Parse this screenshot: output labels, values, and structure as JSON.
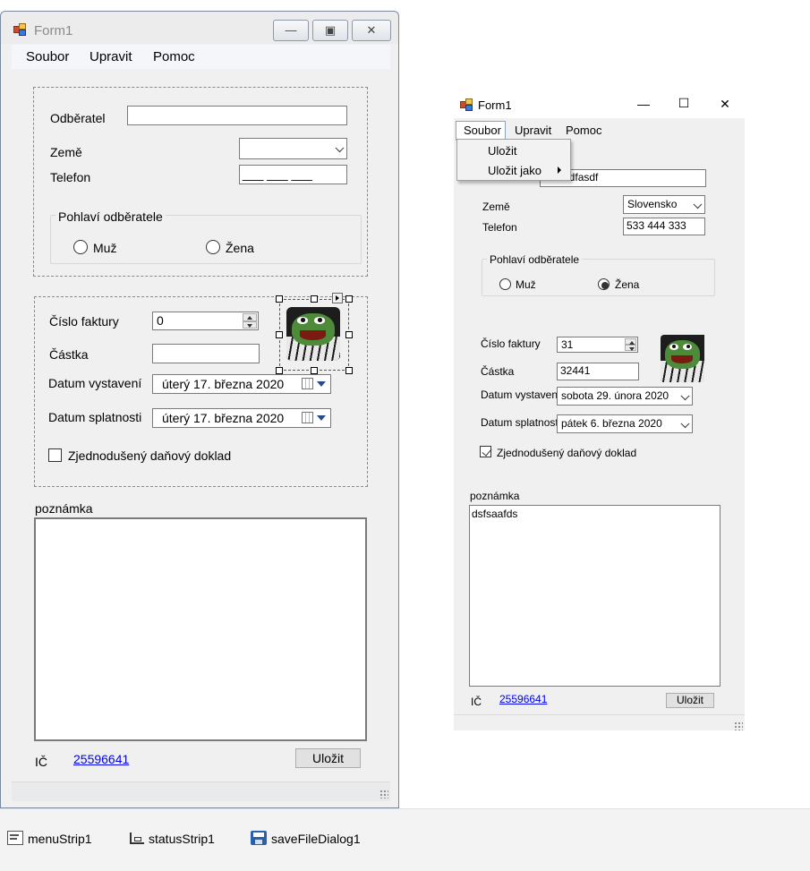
{
  "designer": {
    "title": "Form1",
    "caption_buttons": {
      "minimize": "—",
      "maximize": "▣",
      "close": "✕"
    },
    "menu": [
      "Soubor",
      "Upravit",
      "Pomoc"
    ],
    "labels": {
      "odberatel": "Odběratel",
      "zeme": "Země",
      "telefon": "Telefon",
      "pohlavi_group": "Pohlaví odběratele",
      "muz": "Muž",
      "zena": "Žena",
      "cislo_faktury": "Číslo faktury",
      "castka": "Částka",
      "datum_vystaveni": "Datum vystavení",
      "datum_splatnosti": "Datum splatnosti",
      "zjednoduseny": "Zjednodušený daňový doklad",
      "poznamka": "poznámka",
      "ic": "IČ"
    },
    "values": {
      "odberatel": "",
      "zeme": "",
      "telefon_mask": "___ ___ ___",
      "cislo_faktury": "0",
      "castka": "",
      "datum_vystaveni": "úterý   17.   března   2020",
      "datum_splatnosti": "úterý   17.   března   2020",
      "poznamka": ""
    },
    "ic_link": "25596641",
    "save_button": "Uložit"
  },
  "runtime": {
    "title": "Form1",
    "caption_buttons": {
      "minimize": "—",
      "maximize": "☐",
      "close": "✕"
    },
    "menu": [
      "Soubor",
      "Upravit",
      "Pomoc"
    ],
    "dropdown": [
      "Uložit",
      "Uložit jako"
    ],
    "labels": {
      "zeme": "Země",
      "telefon": "Telefon",
      "pohlavi_group": "Pohlaví odběratele",
      "muz": "Muž",
      "zena": "Žena",
      "cislo_faktury": "Číslo faktury",
      "castka": "Částka",
      "datum_vystaveni": "Datum vystavení",
      "datum_splatnosti": "Datum splatnosti",
      "zjednoduseny": "Zjednodušený daňový doklad",
      "poznamka": "poznámka",
      "ic": "IČ"
    },
    "values": {
      "odberatel": "sdfdsdfasdf",
      "zeme": "Slovensko",
      "telefon": "533 444 333",
      "cislo_faktury": "31",
      "castka": "32441",
      "datum_vystaveni": "sobota  29.   února   2020",
      "datum_splatnosti": "pátek    6.  března   2020",
      "poznamka": "dsfsaafds",
      "gender_selected": "zena",
      "zjednoduseny_checked": true
    },
    "ic_link": "25596641",
    "save_button": "Uložit"
  },
  "tray": [
    "menuStrip1",
    "statusStrip1",
    "saveFileDialog1"
  ]
}
